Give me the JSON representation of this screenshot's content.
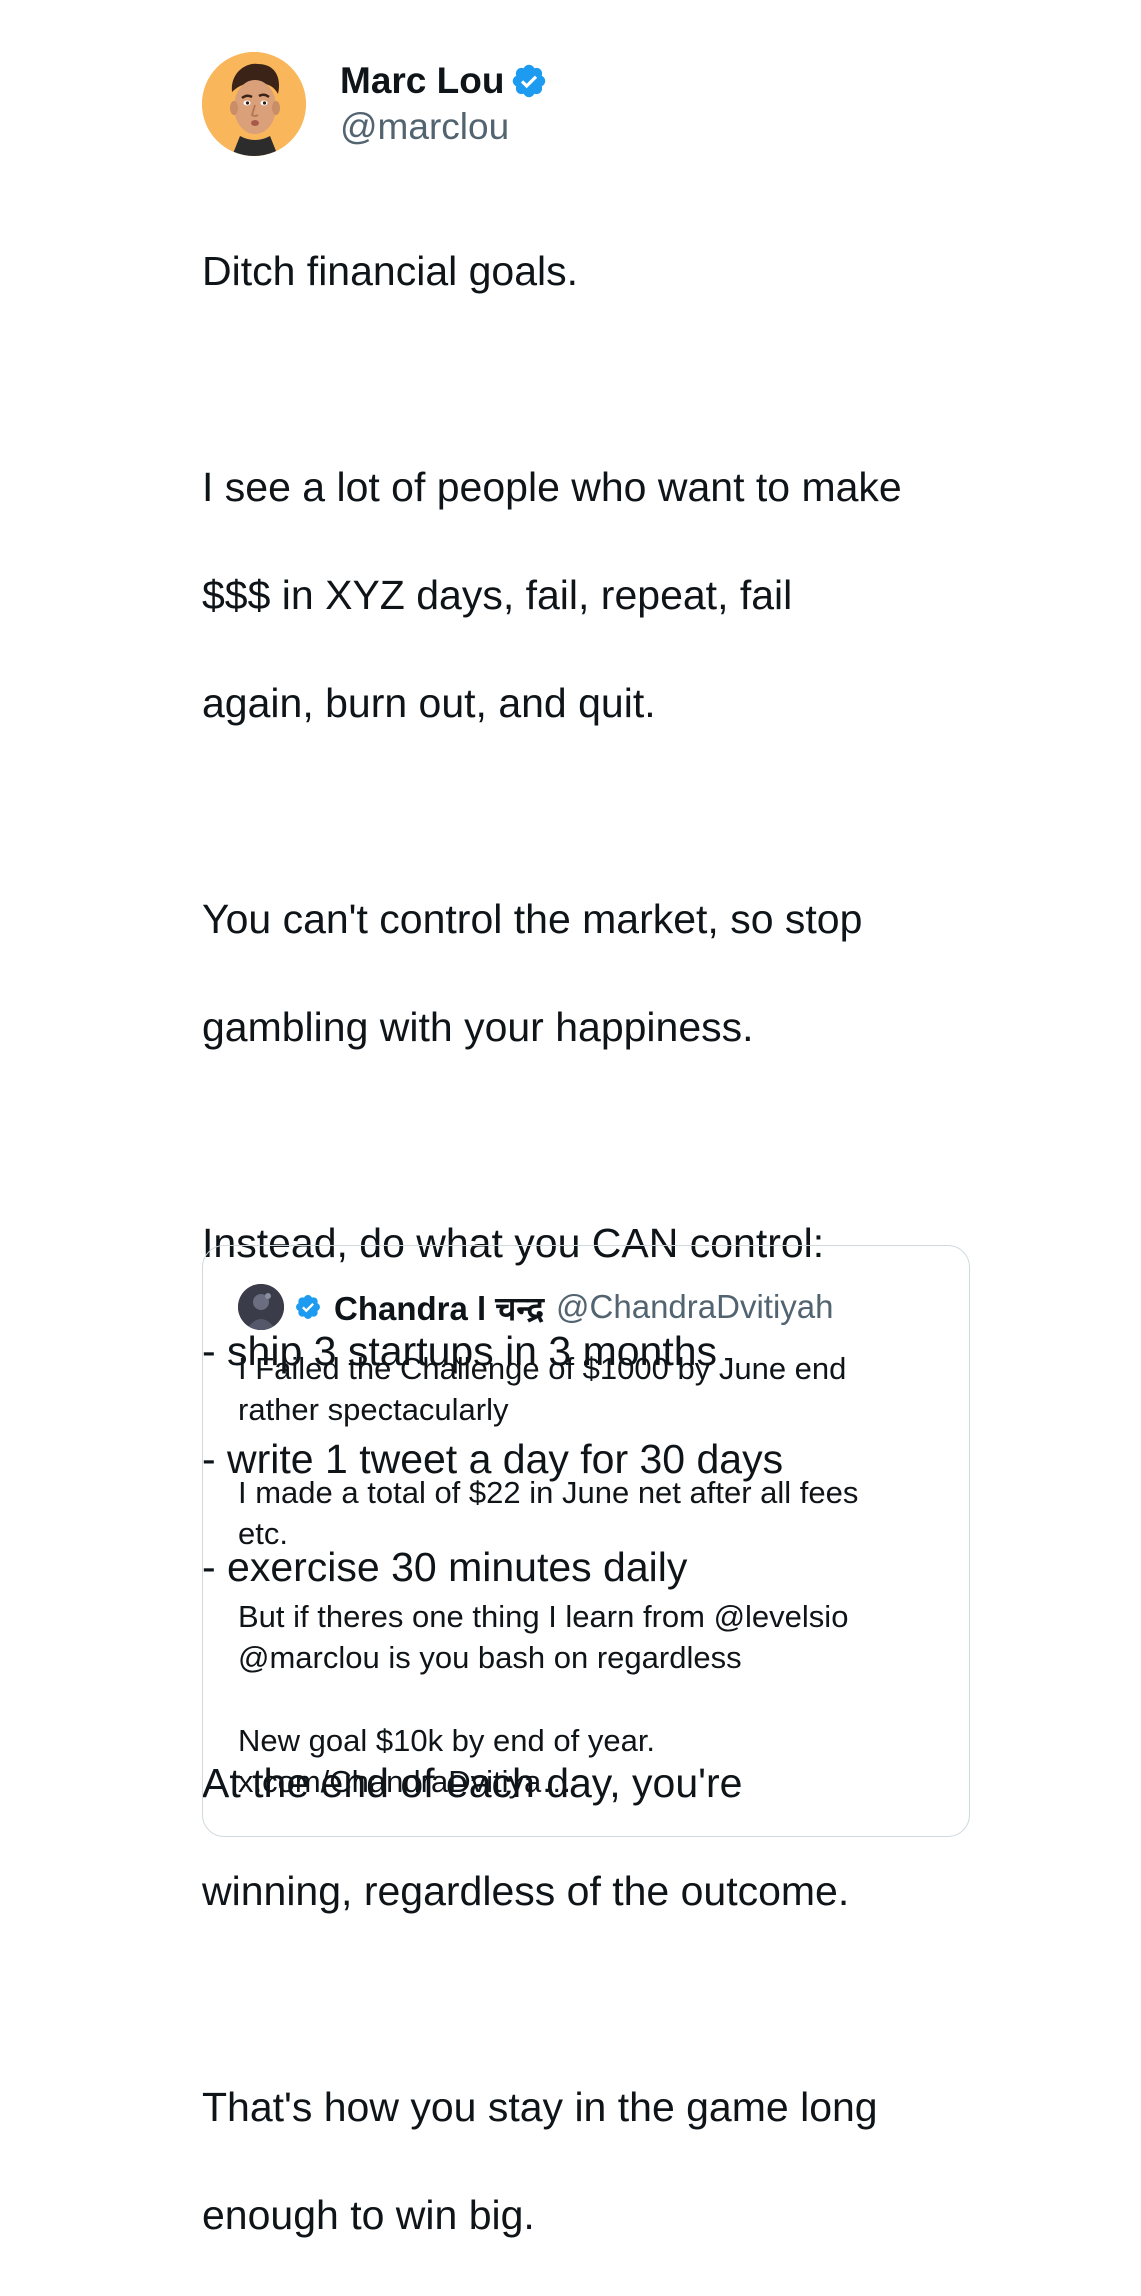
{
  "tweet": {
    "author": {
      "display_name": "Marc Lou",
      "handle": "@marclou",
      "verified_icon": "verified-badge-icon",
      "avatar_color": "#f9b65a"
    },
    "paragraphs": [
      [
        "Ditch financial goals."
      ],
      [
        "I see a lot of people who want to make",
        "$$$ in XYZ days, fail, repeat, fail",
        "again, burn out, and quit."
      ],
      [
        "You can't control the market, so stop",
        "gambling with your happiness."
      ],
      [
        "Instead, do what you CAN control:",
        "- ship 3 startups in 3 months",
        "- write 1 tweet a day for 30 days",
        "- exercise 30 minutes daily"
      ],
      [
        "At the end of each day, you're",
        "winning, regardless of the outcome."
      ],
      [
        "That's how you stay in the game long",
        "enough to win big."
      ]
    ]
  },
  "quoted_tweet": {
    "display_name": "Chandra l चन्द्र",
    "handle": "@ChandraDvitiyah",
    "verified_icon": "verified-badge-icon",
    "paragraphs": [
      [
        "I Failed the Challenge of $1000 by June end",
        "rather spectacularly"
      ],
      [
        "I made a total of $22 in June net after all fees",
        "etc."
      ],
      [
        "But if theres one thing I learn from @levelsio",
        "@marclou is you bash on regardless"
      ],
      [
        "New goal $10k by end of year.",
        "x.com/ChandraDvitiya…"
      ]
    ]
  },
  "colors": {
    "text_primary": "#0f1419",
    "text_secondary": "#536471",
    "verified_blue": "#1d9bf0",
    "card_border": "#cfd9de"
  }
}
